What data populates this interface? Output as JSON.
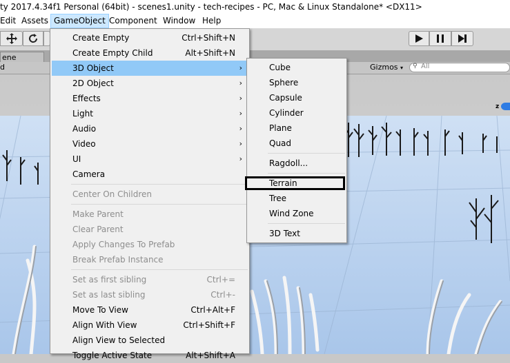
{
  "window": {
    "title": "ty 2017.4.34f1 Personal (64bit) - scenes1.unity - tech-recipes - PC, Mac & Linux Standalone* <DX11>"
  },
  "menubar": {
    "items": [
      {
        "label": "Edit"
      },
      {
        "label": "Assets"
      },
      {
        "label": "GameObject"
      },
      {
        "label": "Component"
      },
      {
        "label": "Window"
      },
      {
        "label": "Help"
      }
    ]
  },
  "toolbar": {
    "icons": [
      "move-icon",
      "rotate-icon",
      "play-icon",
      "pause-icon",
      "step-icon"
    ]
  },
  "tabs": {
    "scene_label": "ene"
  },
  "scenebar": {
    "left_label": "d",
    "gizmos_label": "Gizmos",
    "search_placeholder": "All",
    "axis_label": "z"
  },
  "gameobject_menu": {
    "items": [
      {
        "label": "Create Empty",
        "shortcut": "Ctrl+Shift+N"
      },
      {
        "label": "Create Empty Child",
        "shortcut": "Alt+Shift+N"
      },
      {
        "label": "3D Object",
        "arrow": "›"
      },
      {
        "label": "2D Object",
        "arrow": "›"
      },
      {
        "label": "Effects",
        "arrow": "›"
      },
      {
        "label": "Light",
        "arrow": "›"
      },
      {
        "label": "Audio",
        "arrow": "›"
      },
      {
        "label": "Video",
        "arrow": "›"
      },
      {
        "label": "UI",
        "arrow": "›"
      },
      {
        "label": "Camera"
      },
      {
        "label": "Center On Children"
      },
      {
        "label": "Make Parent"
      },
      {
        "label": "Clear Parent"
      },
      {
        "label": "Apply Changes To Prefab"
      },
      {
        "label": "Break Prefab Instance"
      },
      {
        "label": "Set as first sibling",
        "shortcut": "Ctrl+="
      },
      {
        "label": "Set as last sibling",
        "shortcut": "Ctrl+-"
      },
      {
        "label": "Move To View",
        "shortcut": "Ctrl+Alt+F"
      },
      {
        "label": "Align With View",
        "shortcut": "Ctrl+Shift+F"
      },
      {
        "label": "Align View to Selected"
      },
      {
        "label": "Toggle Active State",
        "shortcut": "Alt+Shift+A"
      }
    ]
  },
  "submenu_3d": {
    "items": [
      {
        "label": "Cube"
      },
      {
        "label": "Sphere"
      },
      {
        "label": "Capsule"
      },
      {
        "label": "Cylinder"
      },
      {
        "label": "Plane"
      },
      {
        "label": "Quad"
      },
      {
        "label": "Ragdoll..."
      },
      {
        "label": "Terrain"
      },
      {
        "label": "Tree"
      },
      {
        "label": "Wind Zone"
      },
      {
        "label": "3D Text"
      }
    ]
  }
}
